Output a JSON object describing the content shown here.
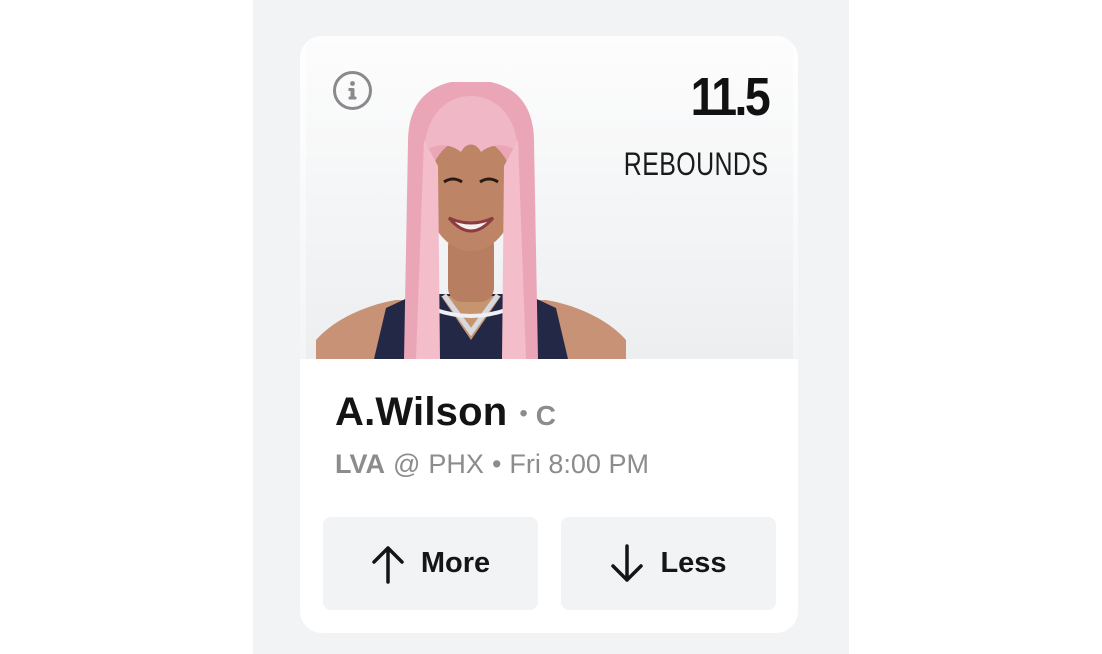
{
  "projection": {
    "value": "11.5",
    "stat": "REBOUNDS"
  },
  "player": {
    "name": "A.Wilson",
    "separator": "•",
    "position": "C",
    "image_icon": "player-headshot"
  },
  "game": {
    "away_team": "LVA",
    "at_symbol": "@",
    "home_team": "PHX",
    "separator": "•",
    "time": "Fri 8:00 PM"
  },
  "actions": {
    "more_label": "More",
    "less_label": "Less",
    "more_icon": "arrow-up-icon",
    "less_icon": "arrow-down-icon",
    "info_icon": "info-icon"
  },
  "colors": {
    "background": "#f2f3f5",
    "card": "#ffffff",
    "text_primary": "#141414",
    "text_secondary": "#8c8c8f",
    "hair": "#f1b8c6",
    "jersey": "#1f2340"
  }
}
